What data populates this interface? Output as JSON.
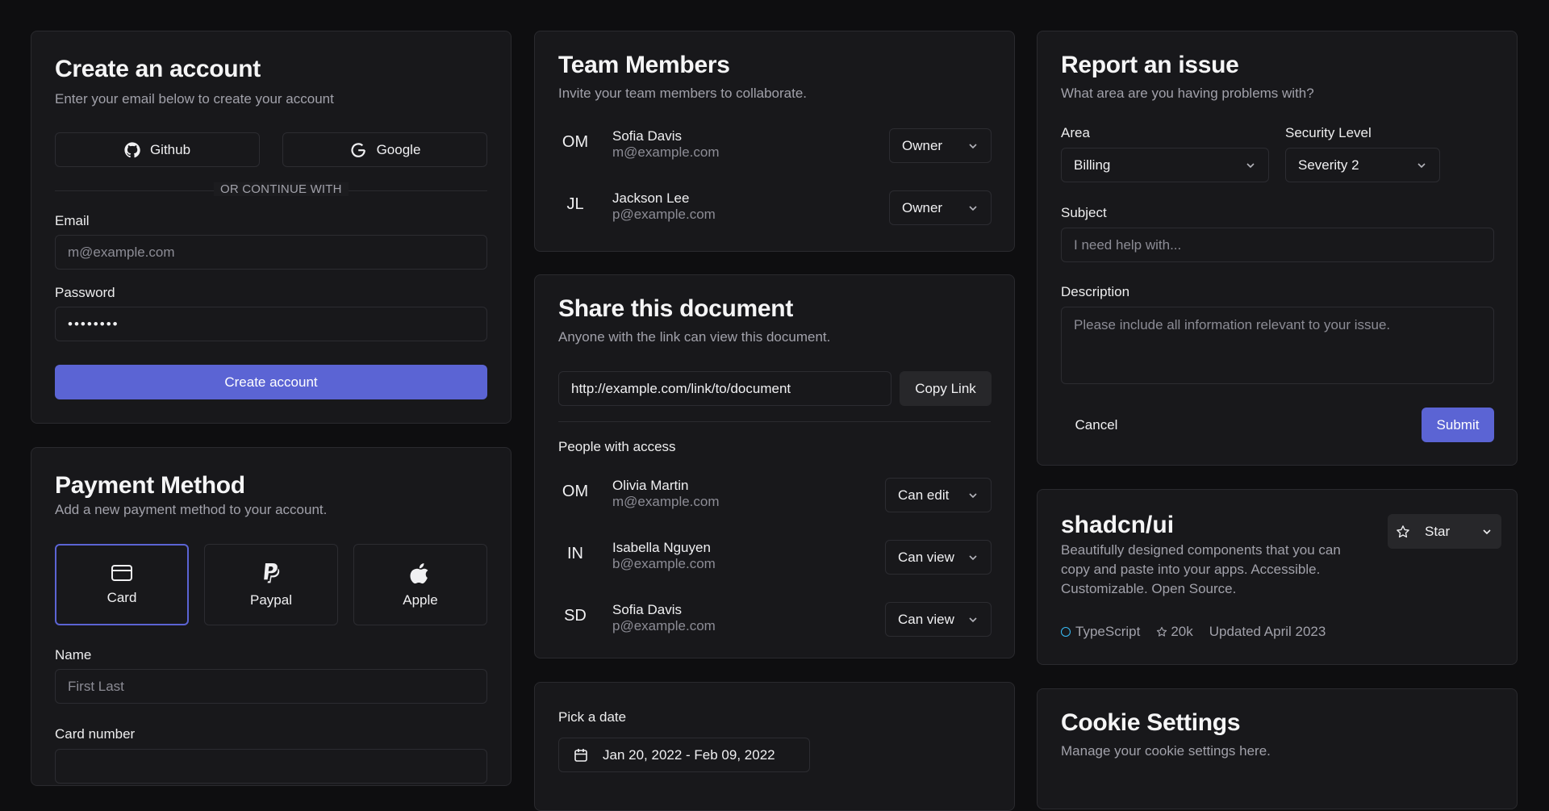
{
  "create_account": {
    "title": "Create an account",
    "subtitle": "Enter your email below to create your account",
    "github_label": "Github",
    "google_label": "Google",
    "divider_text": "OR CONTINUE WITH",
    "email_label": "Email",
    "email_placeholder": "m@example.com",
    "password_label": "Password",
    "password_value": "••••••••",
    "submit_label": "Create account"
  },
  "payment": {
    "title": "Payment Method",
    "subtitle": "Add a new payment method to your account.",
    "options": [
      {
        "label": "Card",
        "icon": "credit-card-icon",
        "selected": true
      },
      {
        "label": "Paypal",
        "icon": "paypal-icon",
        "selected": false
      },
      {
        "label": "Apple",
        "icon": "apple-icon",
        "selected": false
      }
    ],
    "name_label": "Name",
    "name_placeholder": "First Last",
    "card_number_label": "Card number"
  },
  "team": {
    "title": "Team Members",
    "subtitle": "Invite your team members to collaborate.",
    "members": [
      {
        "initials": "OM",
        "name": "Sofia Davis",
        "email": "m@example.com",
        "role": "Owner"
      },
      {
        "initials": "JL",
        "name": "Jackson Lee",
        "email": "p@example.com",
        "role": "Owner"
      }
    ]
  },
  "share": {
    "title": "Share this document",
    "subtitle": "Anyone with the link can view this document.",
    "link": "http://example.com/link/to/document",
    "copy_label": "Copy Link",
    "people_heading": "People with access",
    "people": [
      {
        "initials": "OM",
        "name": "Olivia Martin",
        "email": "m@example.com",
        "access": "Can edit"
      },
      {
        "initials": "IN",
        "name": "Isabella Nguyen",
        "email": "b@example.com",
        "access": "Can view"
      },
      {
        "initials": "SD",
        "name": "Sofia Davis",
        "email": "p@example.com",
        "access": "Can view"
      }
    ]
  },
  "date_picker": {
    "label": "Pick a date",
    "value": "Jan 20, 2022 - Feb 09, 2022"
  },
  "report": {
    "title": "Report an issue",
    "subtitle": "What area are you having problems with?",
    "area_label": "Area",
    "area_value": "Billing",
    "security_label": "Security Level",
    "security_value": "Severity 2",
    "subject_label": "Subject",
    "subject_placeholder": "I need help with...",
    "description_label": "Description",
    "description_placeholder": "Please include all information relevant to your issue.",
    "cancel_label": "Cancel",
    "submit_label": "Submit"
  },
  "repo": {
    "name": "shadcn/ui",
    "description": "Beautifully designed components that you can copy and paste into your apps. Accessible. Customizable. Open Source.",
    "star_label": "Star",
    "language": "TypeScript",
    "stars": "20k",
    "updated": "Updated April 2023",
    "colors": {
      "accent": "#5b64d4",
      "language_dot": "#38bdf8"
    }
  },
  "cookie": {
    "title": "Cookie Settings",
    "subtitle": "Manage your cookie settings here."
  }
}
